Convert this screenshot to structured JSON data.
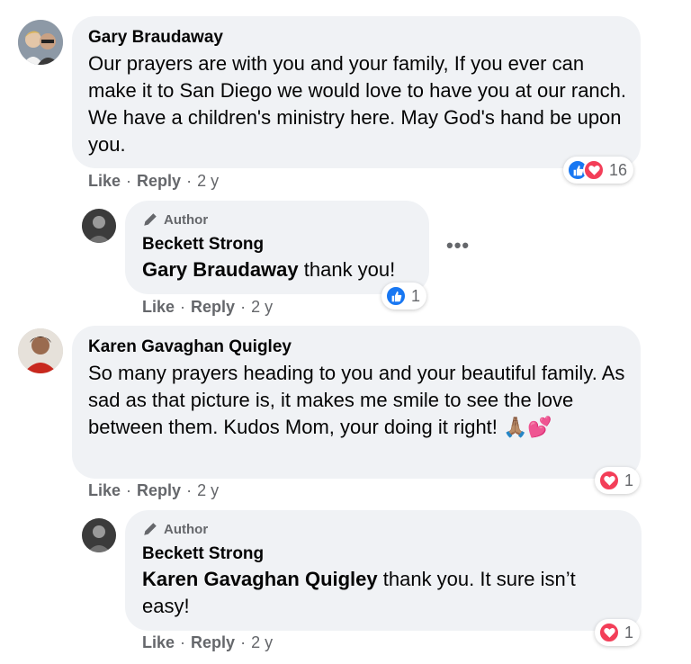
{
  "comments": [
    {
      "name": "Gary Braudaway",
      "text": "Our prayers are with you and your family, If you ever can make it to San Diego we would love to have you at our ranch. We have a children's ministry here. May God's hand be upon you.",
      "actions": {
        "like": "Like",
        "reply": "Reply",
        "time": "2 y"
      },
      "reaction_count": "16"
    },
    {
      "badge": "Author",
      "name": "Beckett Strong",
      "mention": "Gary Braudaway",
      "text": " thank you!",
      "actions": {
        "like": "Like",
        "reply": "Reply",
        "time": "2 y"
      },
      "reaction_count": "1",
      "more_label": "•••"
    },
    {
      "name": "Karen Gavaghan Quigley",
      "text": "So many prayers heading to you and your beautiful family. As sad as that picture is, it makes me smile to see the love between them. Kudos Mom, your doing it right! 🙏🏽💕",
      "actions": {
        "like": "Like",
        "reply": "Reply",
        "time": "2 y"
      },
      "reaction_count": "1"
    },
    {
      "badge": "Author",
      "name": "Beckett Strong",
      "mention": "Karen Gavaghan Quigley",
      "text": " thank you. It sure isn’t easy!",
      "actions": {
        "like": "Like",
        "reply": "Reply",
        "time": "2 y"
      },
      "reaction_count": "1"
    }
  ],
  "separator": "·",
  "colors": {
    "bubble": "#f0f2f5",
    "like": "#1877f2",
    "love": "#f33e58",
    "secondary_text": "#65676b"
  }
}
